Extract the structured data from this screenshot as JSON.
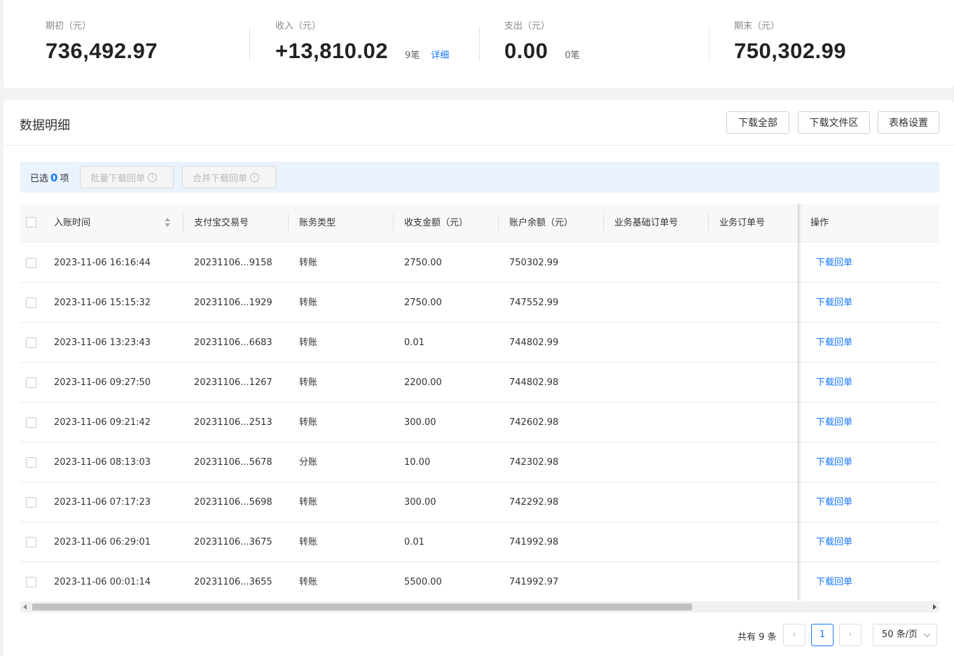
{
  "summary": [
    {
      "label": "期初（元）",
      "value": "736,492.97",
      "count": "",
      "link": ""
    },
    {
      "label": "收入（元）",
      "value": "+13,810.02",
      "count": "9笔",
      "link": "详细"
    },
    {
      "label": "支出（元）",
      "value": "0.00",
      "count": "0笔",
      "link": ""
    },
    {
      "label": "期末（元）",
      "value": "750,302.99",
      "count": "",
      "link": ""
    }
  ],
  "panel": {
    "title": "数据明细",
    "buttons": {
      "download_all": "下载全部",
      "download_files": "下载文件区",
      "table_settings": "表格设置"
    }
  },
  "selection": {
    "prefix": "已选",
    "count": "0",
    "suffix": "项",
    "batch_download": "批量下载回单",
    "merge_download": "合并下载回单"
  },
  "table": {
    "columns": [
      "入账时间",
      "支付宝交易号",
      "账务类型",
      "收支金额（元）",
      "账户余额（元）",
      "业务基础订单号",
      "业务订单号",
      "操作"
    ],
    "rows": [
      {
        "time": "2023-11-06 16:16:44",
        "trade_no": "20231106...9158",
        "type": "转账",
        "amount": "2750.00",
        "balance": "750302.99",
        "action": "下载回单"
      },
      {
        "time": "2023-11-06 15:15:32",
        "trade_no": "20231106...1929",
        "type": "转账",
        "amount": "2750.00",
        "balance": "747552.99",
        "action": "下载回单"
      },
      {
        "time": "2023-11-06 13:23:43",
        "trade_no": "20231106...6683",
        "type": "转账",
        "amount": "0.01",
        "balance": "744802.99",
        "action": "下载回单"
      },
      {
        "time": "2023-11-06 09:27:50",
        "trade_no": "20231106...1267",
        "type": "转账",
        "amount": "2200.00",
        "balance": "744802.98",
        "action": "下载回单"
      },
      {
        "time": "2023-11-06 09:21:42",
        "trade_no": "20231106...2513",
        "type": "转账",
        "amount": "300.00",
        "balance": "742602.98",
        "action": "下载回单"
      },
      {
        "time": "2023-11-06 08:13:03",
        "trade_no": "20231106...5678",
        "type": "分账",
        "amount": "10.00",
        "balance": "742302.98",
        "action": "下载回单"
      },
      {
        "time": "2023-11-06 07:17:23",
        "trade_no": "20231106...5698",
        "type": "转账",
        "amount": "300.00",
        "balance": "742292.98",
        "action": "下载回单"
      },
      {
        "time": "2023-11-06 06:29:01",
        "trade_no": "20231106...3675",
        "type": "转账",
        "amount": "0.01",
        "balance": "741992.98",
        "action": "下载回单"
      },
      {
        "time": "2023-11-06 00:01:14",
        "trade_no": "20231106...3655",
        "type": "转账",
        "amount": "5500.00",
        "balance": "741992.97",
        "action": "下载回单"
      }
    ]
  },
  "pagination": {
    "total": "共有 9 条",
    "prev": "‹",
    "current_page": "1",
    "next": "›",
    "page_size": "50 条/页"
  },
  "colors": {
    "accent": "#1677ff",
    "selection_bar": "#eaf2fd"
  }
}
